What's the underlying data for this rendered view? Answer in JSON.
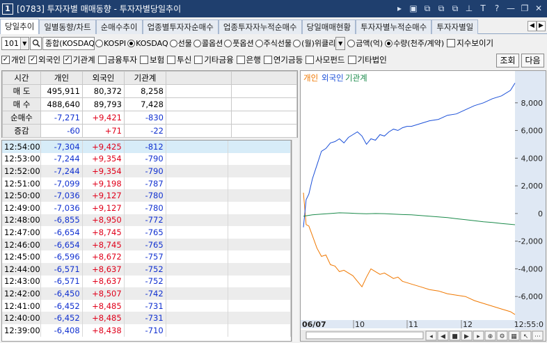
{
  "window": {
    "number": "1",
    "title": "[0783] 투자자별 매매동향 - 투자자별당일추이",
    "icons": [
      "triangle-right-icon",
      "m-icon",
      "window-icon",
      "window2-icon",
      "window3-icon",
      "pin-icon",
      "font-icon",
      "help-icon",
      "minimize-icon",
      "restore-icon",
      "close-icon"
    ],
    "icon_glyphs": [
      "▸",
      "▣",
      "⧉",
      "⧉",
      "⧉",
      "⊥",
      "T",
      "?",
      "—",
      "❐",
      "✕"
    ]
  },
  "tabs": [
    "당일추이",
    "일별동향/차트",
    "순매수추이",
    "업종별투자자순매수",
    "업종투자자누적순매수",
    "당일매매현황",
    "투자자별누적순매수",
    "투자자별일"
  ],
  "tab_nav": [
    "◀",
    "▶"
  ],
  "options": {
    "code": "101",
    "market_combo": "종합(KOSDAQ",
    "radios": [
      {
        "label": "KOSPI",
        "on": false
      },
      {
        "label": "KOSDAQ",
        "on": true
      },
      {
        "label": "선물",
        "on": false
      },
      {
        "label": "콜옵션",
        "on": false
      },
      {
        "label": "풋옵션",
        "on": false
      },
      {
        "label": "주식선물",
        "on": false
      },
      {
        "label": "(월)위클리",
        "on": false
      }
    ],
    "unit_radios": [
      {
        "label": "금액(억)",
        "on": false
      },
      {
        "label": "수량(천주/계약)",
        "on": true
      }
    ],
    "index_check": "지수보이기"
  },
  "investor_checks": [
    {
      "label": "개인",
      "on": true
    },
    {
      "label": "외국인",
      "on": true
    },
    {
      "label": "기관계",
      "on": true
    },
    {
      "label": "금융투자",
      "on": false
    },
    {
      "label": "보험",
      "on": false
    },
    {
      "label": "투신",
      "on": false
    },
    {
      "label": "기타금융",
      "on": false
    },
    {
      "label": "은행",
      "on": false
    },
    {
      "label": "연기금등",
      "on": false
    },
    {
      "label": "사모펀드",
      "on": false
    },
    {
      "label": "기타법인",
      "on": false
    }
  ],
  "buttons": {
    "search": "조회",
    "next": "다음"
  },
  "summary": {
    "headers": [
      "시간",
      "개인",
      "외국인",
      "기관계"
    ],
    "rows": [
      {
        "label": "매 도",
        "vals": [
          "495,911",
          "80,372",
          "8,258"
        ]
      },
      {
        "label": "매 수",
        "vals": [
          "488,640",
          "89,793",
          "7,428"
        ]
      },
      {
        "label": "순매수",
        "vals": [
          "-7,271",
          "+9,421",
          "-830"
        ]
      },
      {
        "label": "증감",
        "vals": [
          "-60",
          "+71",
          "-22"
        ]
      }
    ]
  },
  "timeline": [
    [
      "12:54:00",
      "-7,304",
      "+9,425",
      "-812"
    ],
    [
      "12:53:00",
      "-7,244",
      "+9,354",
      "-790"
    ],
    [
      "12:52:00",
      "-7,244",
      "+9,354",
      "-790"
    ],
    [
      "12:51:00",
      "-7,099",
      "+9,198",
      "-787"
    ],
    [
      "12:50:00",
      "-7,036",
      "+9,127",
      "-780"
    ],
    [
      "12:49:00",
      "-7,036",
      "+9,127",
      "-780"
    ],
    [
      "12:48:00",
      "-6,855",
      "+8,950",
      "-772"
    ],
    [
      "12:47:00",
      "-6,654",
      "+8,745",
      "-765"
    ],
    [
      "12:46:00",
      "-6,654",
      "+8,745",
      "-765"
    ],
    [
      "12:45:00",
      "-6,596",
      "+8,672",
      "-757"
    ],
    [
      "12:44:00",
      "-6,571",
      "+8,637",
      "-752"
    ],
    [
      "12:43:00",
      "-6,571",
      "+8,637",
      "-752"
    ],
    [
      "12:42:00",
      "-6,450",
      "+8,507",
      "-742"
    ],
    [
      "12:41:00",
      "-6,452",
      "+8,485",
      "-731"
    ],
    [
      "12:40:00",
      "-6,452",
      "+8,485",
      "-731"
    ],
    [
      "12:39:00",
      "-6,408",
      "+8,438",
      "-710"
    ]
  ],
  "colors": {
    "individual": "#f07800",
    "foreign": "#1a4fd8",
    "institution": "#1a8a4a"
  },
  "chart_data": {
    "type": "line",
    "legend": [
      "개인",
      "외국인",
      "기관계"
    ],
    "legend_position": "top-left",
    "ylim": [
      -7400,
      9900
    ],
    "yticks": [
      -6000,
      -4000,
      -2000,
      0,
      2000,
      4000,
      6000,
      8000
    ],
    "ytick_labels": [
      "-6,000",
      "-4,000",
      "-2,000",
      "0",
      "2,000",
      "4,000",
      "6,000",
      "8,000"
    ],
    "x_labels": [
      "06/07",
      "10",
      "11",
      "12"
    ],
    "x_last_label": "12:55:0",
    "x_start_time": "09:00",
    "x_end_time": "12:55",
    "series": [
      {
        "name": "개인",
        "points": [
          [
            0,
            1500
          ],
          [
            3,
            -800
          ],
          [
            6,
            -900
          ],
          [
            10,
            -1600
          ],
          [
            15,
            -2500
          ],
          [
            20,
            -3100
          ],
          [
            25,
            -3000
          ],
          [
            30,
            -3700
          ],
          [
            35,
            -3800
          ],
          [
            40,
            -4200
          ],
          [
            45,
            -4100
          ],
          [
            50,
            -4300
          ],
          [
            55,
            -4500
          ],
          [
            60,
            -4900
          ],
          [
            65,
            -5300
          ],
          [
            70,
            -4600
          ],
          [
            75,
            -4000
          ],
          [
            80,
            -4200
          ],
          [
            85,
            -4400
          ],
          [
            90,
            -4300
          ],
          [
            95,
            -4500
          ],
          [
            100,
            -4700
          ],
          [
            105,
            -4600
          ],
          [
            110,
            -4900
          ],
          [
            115,
            -5000
          ],
          [
            120,
            -5100
          ],
          [
            130,
            -5300
          ],
          [
            140,
            -5500
          ],
          [
            150,
            -5600
          ],
          [
            160,
            -5800
          ],
          [
            170,
            -5900
          ],
          [
            180,
            -6000
          ],
          [
            190,
            -6300
          ],
          [
            200,
            -6500
          ],
          [
            210,
            -6700
          ],
          [
            220,
            -6900
          ],
          [
            230,
            -7100
          ],
          [
            235,
            -7304
          ]
        ]
      },
      {
        "name": "외국인",
        "points": [
          [
            0,
            -1000
          ],
          [
            3,
            1000
          ],
          [
            6,
            1400
          ],
          [
            10,
            2500
          ],
          [
            15,
            3500
          ],
          [
            20,
            4500
          ],
          [
            25,
            4700
          ],
          [
            30,
            5100
          ],
          [
            35,
            5200
          ],
          [
            40,
            5400
          ],
          [
            45,
            5100
          ],
          [
            50,
            5500
          ],
          [
            55,
            5700
          ],
          [
            60,
            5900
          ],
          [
            65,
            5600
          ],
          [
            70,
            5000
          ],
          [
            75,
            5400
          ],
          [
            80,
            5300
          ],
          [
            85,
            5700
          ],
          [
            90,
            5600
          ],
          [
            95,
            5900
          ],
          [
            100,
            6100
          ],
          [
            105,
            6000
          ],
          [
            110,
            6200
          ],
          [
            115,
            6300
          ],
          [
            120,
            6300
          ],
          [
            130,
            6500
          ],
          [
            140,
            6700
          ],
          [
            150,
            6800
          ],
          [
            160,
            7100
          ],
          [
            170,
            7200
          ],
          [
            180,
            7500
          ],
          [
            190,
            7800
          ],
          [
            200,
            8000
          ],
          [
            210,
            8300
          ],
          [
            220,
            8500
          ],
          [
            230,
            8900
          ],
          [
            235,
            9425
          ]
        ]
      },
      {
        "name": "기관계",
        "points": [
          [
            0,
            -200
          ],
          [
            10,
            -100
          ],
          [
            20,
            -50
          ],
          [
            30,
            0
          ],
          [
            40,
            50
          ],
          [
            50,
            30
          ],
          [
            60,
            0
          ],
          [
            70,
            -20
          ],
          [
            80,
            0
          ],
          [
            90,
            -10
          ],
          [
            100,
            -50
          ],
          [
            110,
            -80
          ],
          [
            120,
            -100
          ],
          [
            130,
            -150
          ],
          [
            140,
            -200
          ],
          [
            150,
            -250
          ],
          [
            160,
            -300
          ],
          [
            170,
            -380
          ],
          [
            180,
            -450
          ],
          [
            190,
            -520
          ],
          [
            200,
            -600
          ],
          [
            210,
            -650
          ],
          [
            220,
            -720
          ],
          [
            230,
            -780
          ],
          [
            235,
            -812
          ]
        ]
      }
    ]
  }
}
